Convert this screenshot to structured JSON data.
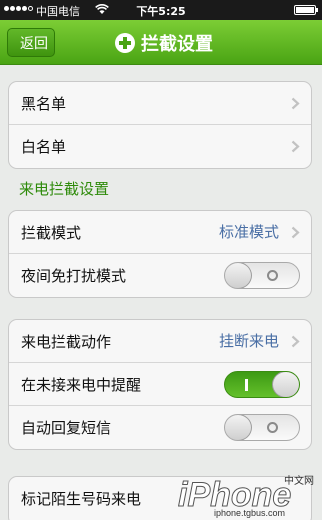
{
  "status_bar": {
    "carrier": "中国电信",
    "time": "下午5:25",
    "signal_bars": 4,
    "signal_total": 5,
    "battery_level": 1.0
  },
  "nav": {
    "back_label": "返回",
    "title": "拦截设置",
    "title_icon": "shield-plus-icon"
  },
  "lists": {
    "items": [
      {
        "label": "黑名单"
      },
      {
        "label": "白名单"
      }
    ]
  },
  "incoming_section": {
    "header": "来电拦截设置",
    "block_mode": {
      "label": "拦截模式",
      "value": "标准模式"
    },
    "dnd_night": {
      "label": "夜间免打扰模式",
      "on": false
    }
  },
  "actions": {
    "action": {
      "label": "来电拦截动作",
      "value": "挂断来电"
    },
    "remind_missed": {
      "label": "在未接来电中提醒",
      "on": true
    },
    "auto_reply": {
      "label": "自动回复短信",
      "on": false
    }
  },
  "partial_row": {
    "label": "标记陌生号码来电"
  },
  "watermark": {
    "brand": "iPhone",
    "tag": "中文网",
    "url": "iphone.tgbus.com"
  },
  "colors": {
    "nav_green": "#4aa414",
    "section_green": "#2e8b0a",
    "value_blue": "#4a6fa5",
    "toggle_on": "#4fae1c"
  }
}
